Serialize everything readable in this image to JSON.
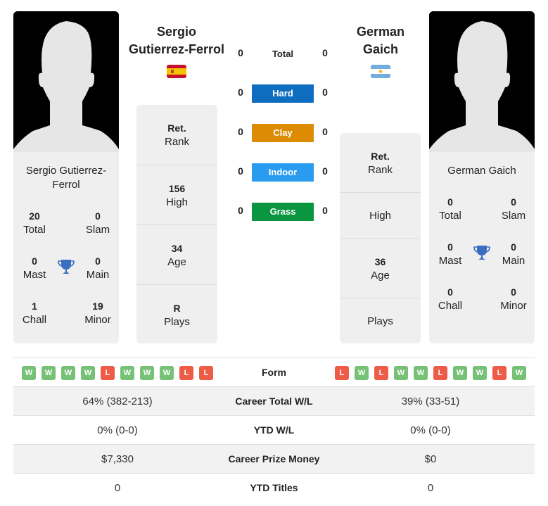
{
  "player1": {
    "title_name_line1": "Sergio",
    "title_name_line2": "Gutierrez-Ferrol",
    "card_name": "Sergio Gutierrez-Ferrol",
    "country": "Spain",
    "flag_icon": "spain-flag-icon",
    "titles": {
      "total": {
        "value": "20",
        "label": "Total"
      },
      "slam": {
        "value": "0",
        "label": "Slam"
      },
      "mast": {
        "value": "0",
        "label": "Mast"
      },
      "main": {
        "value": "0",
        "label": "Main"
      },
      "chall": {
        "value": "1",
        "label": "Chall"
      },
      "minor": {
        "value": "19",
        "label": "Minor"
      }
    },
    "info": {
      "rank": {
        "value": "Ret.",
        "label": "Rank"
      },
      "high": {
        "value": "156",
        "label": "High"
      },
      "age": {
        "value": "34",
        "label": "Age"
      },
      "plays": {
        "value": "R",
        "label": "Plays"
      }
    }
  },
  "player2": {
    "title_name_line1": "German",
    "title_name_line2": "Gaich",
    "card_name": "German Gaich",
    "country": "Argentina",
    "flag_icon": "argentina-flag-icon",
    "titles": {
      "total": {
        "value": "0",
        "label": "Total"
      },
      "slam": {
        "value": "0",
        "label": "Slam"
      },
      "mast": {
        "value": "0",
        "label": "Mast"
      },
      "main": {
        "value": "0",
        "label": "Main"
      },
      "chall": {
        "value": "0",
        "label": "Chall"
      },
      "minor": {
        "value": "0",
        "label": "Minor"
      }
    },
    "info": {
      "rank": {
        "value": "Ret.",
        "label": "Rank"
      },
      "high": {
        "value": "",
        "label": "High"
      },
      "age": {
        "value": "36",
        "label": "Age"
      },
      "plays": {
        "value": "",
        "label": "Plays"
      }
    }
  },
  "h2h": {
    "total": {
      "label": "Total",
      "p1": "0",
      "p2": "0"
    },
    "surfaces": [
      {
        "label": "Hard",
        "p1": "0",
        "p2": "0",
        "color": "#0e6dbf"
      },
      {
        "label": "Clay",
        "p1": "0",
        "p2": "0",
        "color": "#dd8b05"
      },
      {
        "label": "Indoor",
        "p1": "0",
        "p2": "0",
        "color": "#2a9cf0"
      },
      {
        "label": "Grass",
        "p1": "0",
        "p2": "0",
        "color": "#0a9640"
      }
    ]
  },
  "comparison": {
    "form_label": "Form",
    "p1_form": [
      "W",
      "W",
      "W",
      "W",
      "L",
      "W",
      "W",
      "W",
      "L",
      "L"
    ],
    "p2_form": [
      "L",
      "W",
      "L",
      "W",
      "W",
      "L",
      "W",
      "W",
      "L",
      "W"
    ],
    "rows": [
      {
        "label": "Career Total W/L",
        "p1": "64% (382-213)",
        "p2": "39% (33-51)"
      },
      {
        "label": "YTD W/L",
        "p1": "0% (0-0)",
        "p2": "0% (0-0)"
      },
      {
        "label": "Career Prize Money",
        "p1": "$7,330",
        "p2": "$0"
      },
      {
        "label": "YTD Titles",
        "p1": "0",
        "p2": "0"
      }
    ]
  },
  "colors": {
    "win": "#77c177",
    "loss": "#ee5c48",
    "trophy": "#3a6fbf"
  }
}
